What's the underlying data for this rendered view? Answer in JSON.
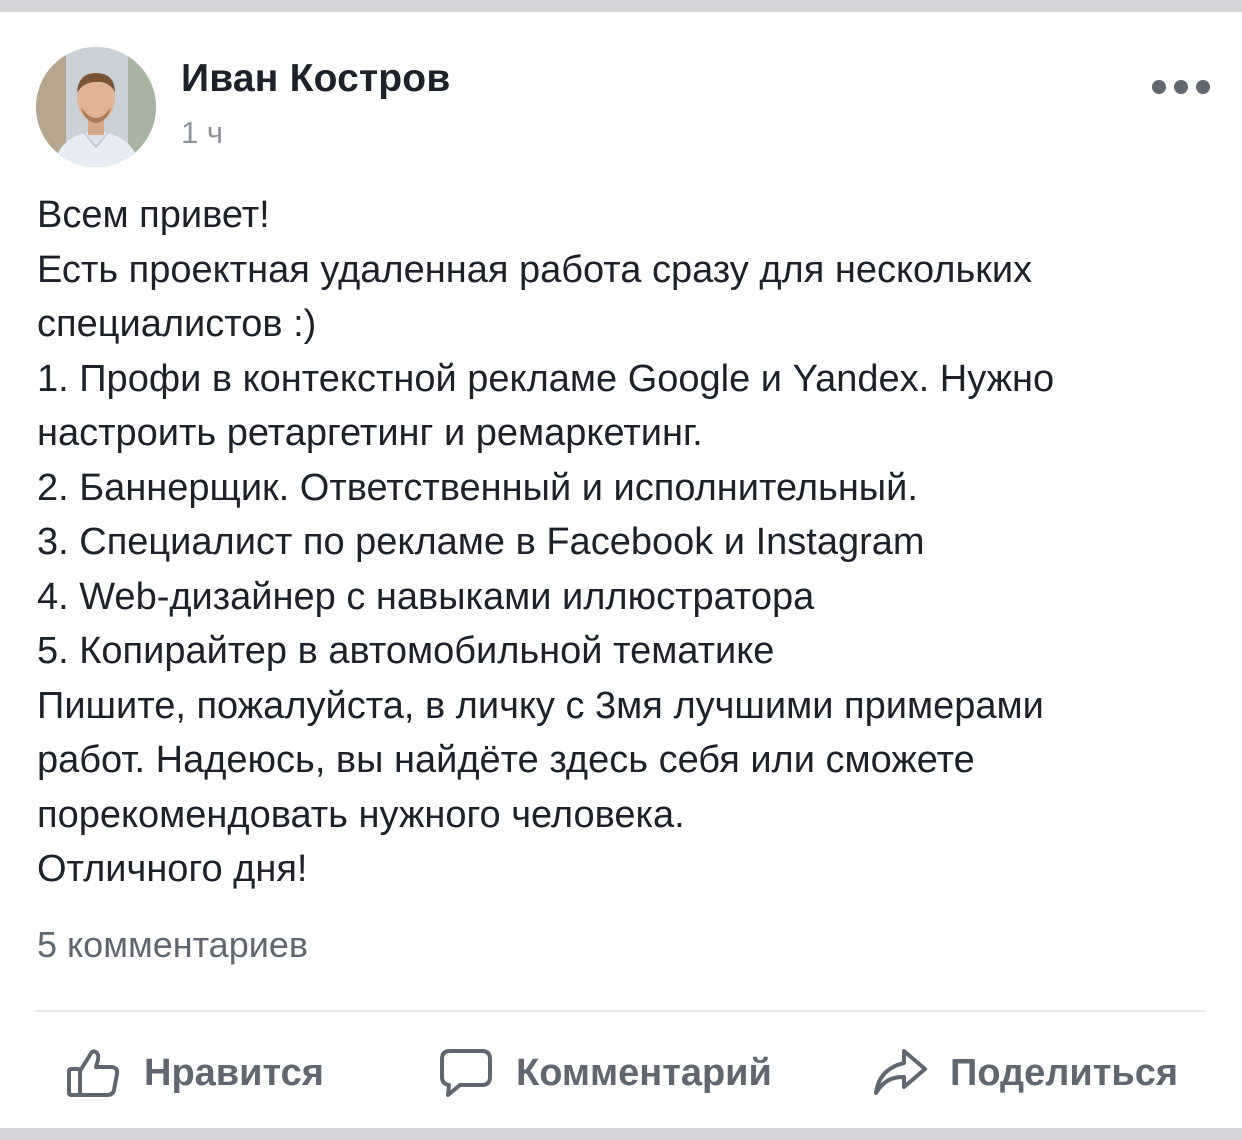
{
  "post": {
    "author": "Иван Костров",
    "time": "1 ч",
    "more_icon": "more-horizontal-icon",
    "body_lines": [
      "Всем привет!",
      "Есть проектная удаленная работа сразу для нескольких",
      "специалистов :)",
      "1. Профи в контекстной рекламе Google и Yandex. Нужно",
      "настроить ретаргетинг и ремаркетинг.",
      "2. Баннерщик. Ответственный и исполнительный.",
      "3. Специалист по рекламе в Facebook и Instagram",
      "4. Web-дизайнер с навыками иллюстратора",
      "5. Копирайтер в автомобильной тематике",
      "Пишите, пожалуйста, в личку с 3мя лучшими примерами",
      "работ. Надеюсь, вы найдёте здесь себя или сможете",
      "порекомендовать нужного человека.",
      "Отличного дня!"
    ],
    "comments_count": "5 комментариев"
  },
  "actions": {
    "like": {
      "label": "Нравится",
      "icon": "thumbs-up-icon"
    },
    "comment": {
      "label": "Комментарий",
      "icon": "comment-bubble-icon"
    },
    "share": {
      "label": "Поделиться",
      "icon": "share-arrow-icon"
    }
  },
  "colors": {
    "text_primary": "#1d2129",
    "text_secondary": "#90949c",
    "action_gray": "#606770",
    "divider": "#e4e6eb"
  }
}
